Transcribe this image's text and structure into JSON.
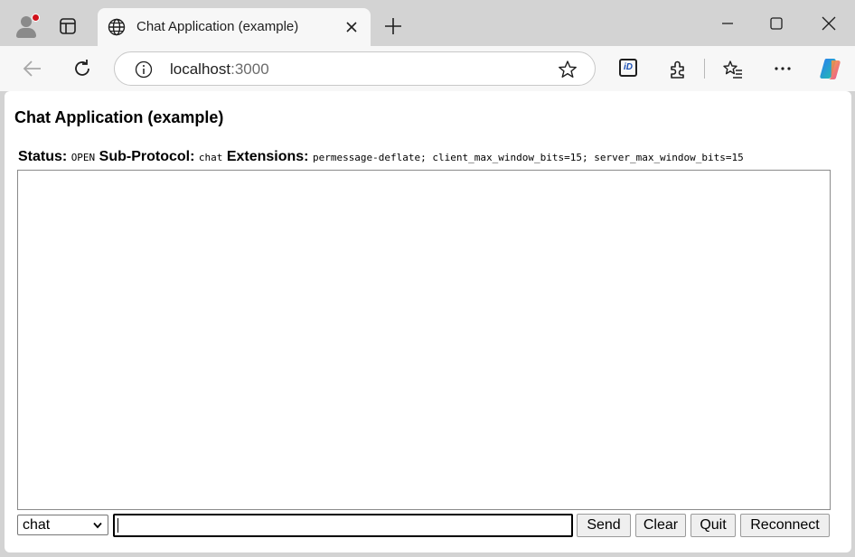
{
  "browser": {
    "tab_title": "Chat Application (example)",
    "address": {
      "host": "localhost",
      "port": ":3000"
    },
    "icons": [
      "profile-icon",
      "tab-actions-icon",
      "globe-icon",
      "close-tab-icon",
      "new-tab-icon",
      "minimize-icon",
      "maximize-icon",
      "close-window-icon",
      "back-icon",
      "refresh-icon",
      "info-icon",
      "favorite-star-icon",
      "id-extension-icon",
      "extensions-icon",
      "favorites-icon",
      "more-icon",
      "copilot-icon"
    ],
    "id_badge": "iD"
  },
  "page": {
    "title": "Chat Application (example)",
    "status_label": "Status:",
    "status_value": "OPEN",
    "subprotocol_label": "Sub-Protocol:",
    "subprotocol_value": "chat",
    "extensions_label": "Extensions:",
    "extensions_value": "permessage-deflate; client_max_window_bits=15; server_max_window_bits=15",
    "protocol_select": {
      "selected": "chat"
    },
    "message_input": {
      "value": ""
    },
    "buttons": {
      "send": "Send",
      "clear": "Clear",
      "quit": "Quit",
      "reconnect": "Reconnect"
    }
  },
  "colors": {
    "chrome": "#d3d3d3",
    "toolbar": "#f7f7f7",
    "notification_dot": "#d0111b"
  }
}
